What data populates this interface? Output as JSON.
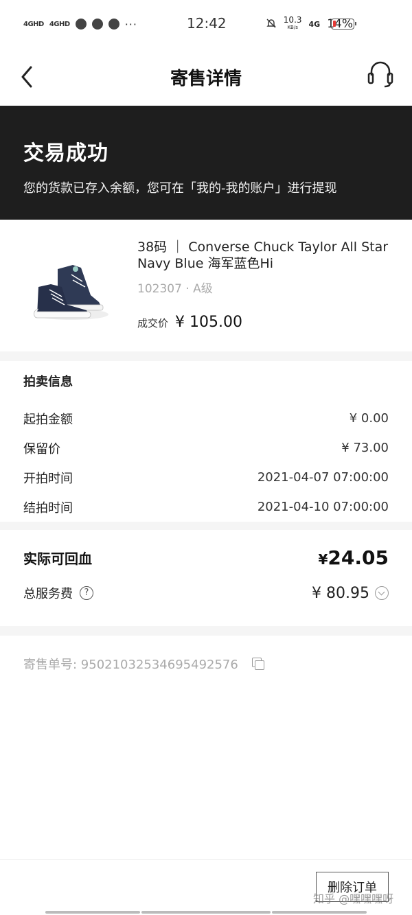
{
  "status_bar": {
    "signal1": "4GHD",
    "signal2": "4GHD",
    "time": "12:42",
    "net_speed": "10.3",
    "net_unit": "KB/s",
    "net_type": "4G",
    "battery": "14%",
    "battery_color": "#e53935"
  },
  "nav": {
    "title": "寄售详情",
    "back_icon": "chevron-left-icon",
    "service_icon": "headset-icon"
  },
  "banner": {
    "title": "交易成功",
    "subtitle": "您的货款已存入余额，您可在「我的-我的账户」进行提现",
    "bg_color": "#1e1e1e"
  },
  "product": {
    "name": "38码 ｜ Converse Chuck Taylor All Star Navy Blue 海军蓝色Hi",
    "sku": "102307 · A级",
    "price_label": "成交价",
    "price": "¥ 105.00"
  },
  "auction": {
    "title": "拍卖信息",
    "rows": [
      {
        "label": "起拍金额",
        "value": "¥ 0.00"
      },
      {
        "label": "保留价",
        "value": "¥ 73.00"
      },
      {
        "label": "开拍时间",
        "value": "2021-04-07 07:00:00"
      },
      {
        "label": "结拍时间",
        "value": "2021-04-10 07:00:00"
      }
    ]
  },
  "payout": {
    "label": "实际可回血",
    "currency": "¥",
    "amount": "24.05",
    "fee_label": "总服务费",
    "fee_value": "¥ 80.95"
  },
  "order": {
    "number_text": "寄售单号: 950210325346954925​76"
  },
  "actions": {
    "delete_label": "删除订单"
  },
  "watermark": "知乎 @嘿嘿嘿呀"
}
